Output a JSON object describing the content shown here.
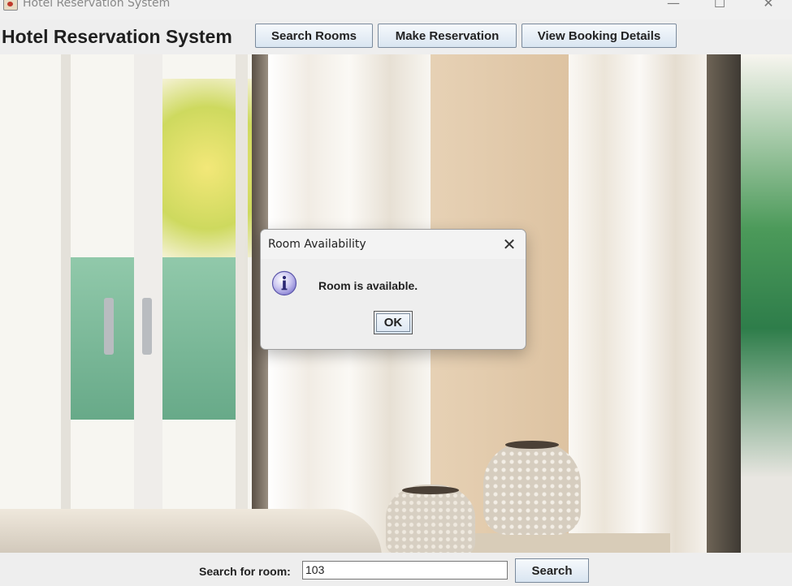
{
  "window": {
    "title": "Hotel Reservation System",
    "controls": {
      "minimize": "—",
      "maximize": "☐",
      "close": "✕"
    }
  },
  "header": {
    "heading": "Hotel Reservation System",
    "buttons": [
      {
        "label": "Search Rooms"
      },
      {
        "label": "Make Reservation"
      },
      {
        "label": "View Booking Details"
      }
    ]
  },
  "dialog": {
    "title": "Room Availability",
    "icon": "info-icon",
    "message": "Room is available.",
    "ok_label": "OK",
    "close_glyph": "✕"
  },
  "search": {
    "label": "Search for room:",
    "value": "103",
    "button_label": "Search"
  }
}
